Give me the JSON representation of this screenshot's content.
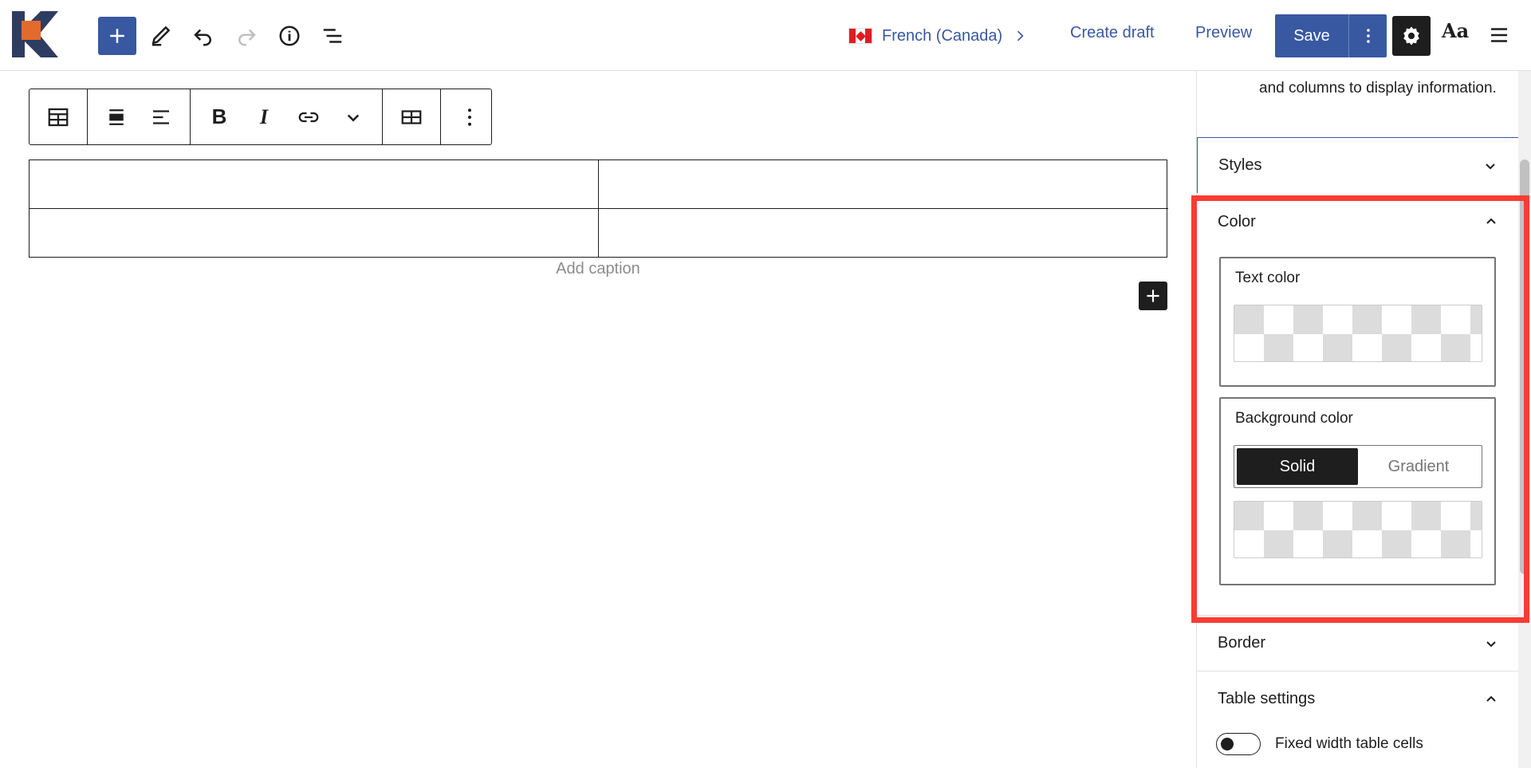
{
  "topbar": {
    "language": "French (Canada)",
    "create_draft": "Create draft",
    "preview": "Preview",
    "save": "Save",
    "typography_label": "Aa",
    "colors": {
      "accent": "#3858a1",
      "logo_orange": "#e26a2c",
      "logo_navy": "#2f3c62"
    }
  },
  "block_toolbar": {
    "icons": [
      "table-icon",
      "align-wide-icon",
      "align-left-icon",
      "bold-icon",
      "italic-icon",
      "link-icon",
      "chevron-down-icon",
      "table-edit-icon",
      "more-vertical-icon"
    ],
    "bold_label": "B",
    "italic_label": "I"
  },
  "table": {
    "rows": [
      [
        "",
        ""
      ],
      [
        "",
        ""
      ]
    ],
    "caption_placeholder": "Add caption"
  },
  "sidebar": {
    "description": "and columns to display information.",
    "panels": {
      "styles": "Styles",
      "color": "Color",
      "border": "Border",
      "table_settings": "Table settings"
    },
    "color": {
      "text_color_label": "Text color",
      "background_color_label": "Background color",
      "tabs": [
        "Solid",
        "Gradient"
      ],
      "active_tab": "Solid"
    },
    "table_settings": {
      "fixed_width_label": "Fixed width table cells",
      "fixed_width_enabled": false
    }
  },
  "highlight_color": "#f93c33"
}
